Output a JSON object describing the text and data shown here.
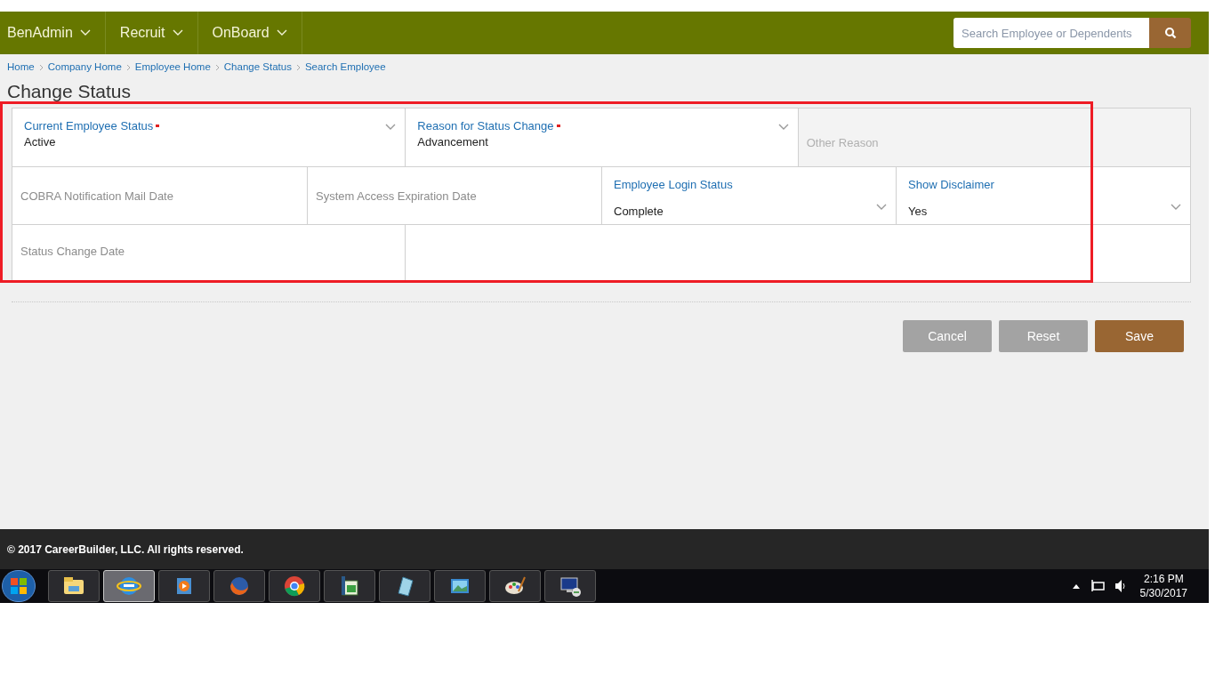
{
  "nav": {
    "menus": [
      {
        "label": "BenAdmin"
      },
      {
        "label": "Recruit"
      },
      {
        "label": "OnBoard"
      }
    ],
    "search": {
      "placeholder": "Search Employee or Dependents"
    }
  },
  "breadcrumb": [
    "Home",
    "Company Home",
    "Employee Home",
    "Change Status",
    "Search Employee"
  ],
  "page_title": "Change Status",
  "form": {
    "rows": [
      [
        {
          "kind": "select",
          "label": "Current Employee Status",
          "required": true,
          "value": "Active"
        },
        {
          "kind": "select",
          "label": "Reason for Status Change",
          "required": true,
          "value": "Advancement"
        },
        {
          "kind": "text",
          "placeholder": "Other Reason",
          "disabled": true
        }
      ],
      [
        {
          "kind": "text",
          "placeholder": "COBRA Notification Mail Date",
          "disabled": false
        },
        {
          "kind": "text",
          "placeholder": "System Access Expiration Date",
          "disabled": false
        },
        {
          "kind": "select",
          "label": "Employee Login Status",
          "required": false,
          "value": "Complete"
        },
        {
          "kind": "select",
          "label": "Show Disclaimer",
          "required": false,
          "value": "Yes"
        }
      ],
      [
        {
          "kind": "text",
          "placeholder": "Status Change Date",
          "disabled": false
        },
        {
          "kind": "blank"
        }
      ]
    ]
  },
  "buttons": [
    {
      "label": "Cancel",
      "kind": "secondary"
    },
    {
      "label": "Reset",
      "kind": "secondary"
    },
    {
      "label": "Save",
      "kind": "primary"
    }
  ],
  "footer": "© 2017 CareerBuilder, LLC. All rights reserved.",
  "taskbar": {
    "apps": [
      {
        "kind": "folder",
        "selected": false
      },
      {
        "kind": "browser-e",
        "selected": true
      },
      {
        "kind": "media",
        "selected": false
      },
      {
        "kind": "fox",
        "selected": false
      },
      {
        "kind": "chrome",
        "selected": false
      },
      {
        "kind": "sheet",
        "selected": false
      },
      {
        "kind": "notepad",
        "selected": false
      },
      {
        "kind": "picture",
        "selected": false
      },
      {
        "kind": "paint",
        "selected": false
      },
      {
        "kind": "remote",
        "selected": false
      }
    ],
    "time": "2:16 PM",
    "date": "5/30/2017"
  }
}
